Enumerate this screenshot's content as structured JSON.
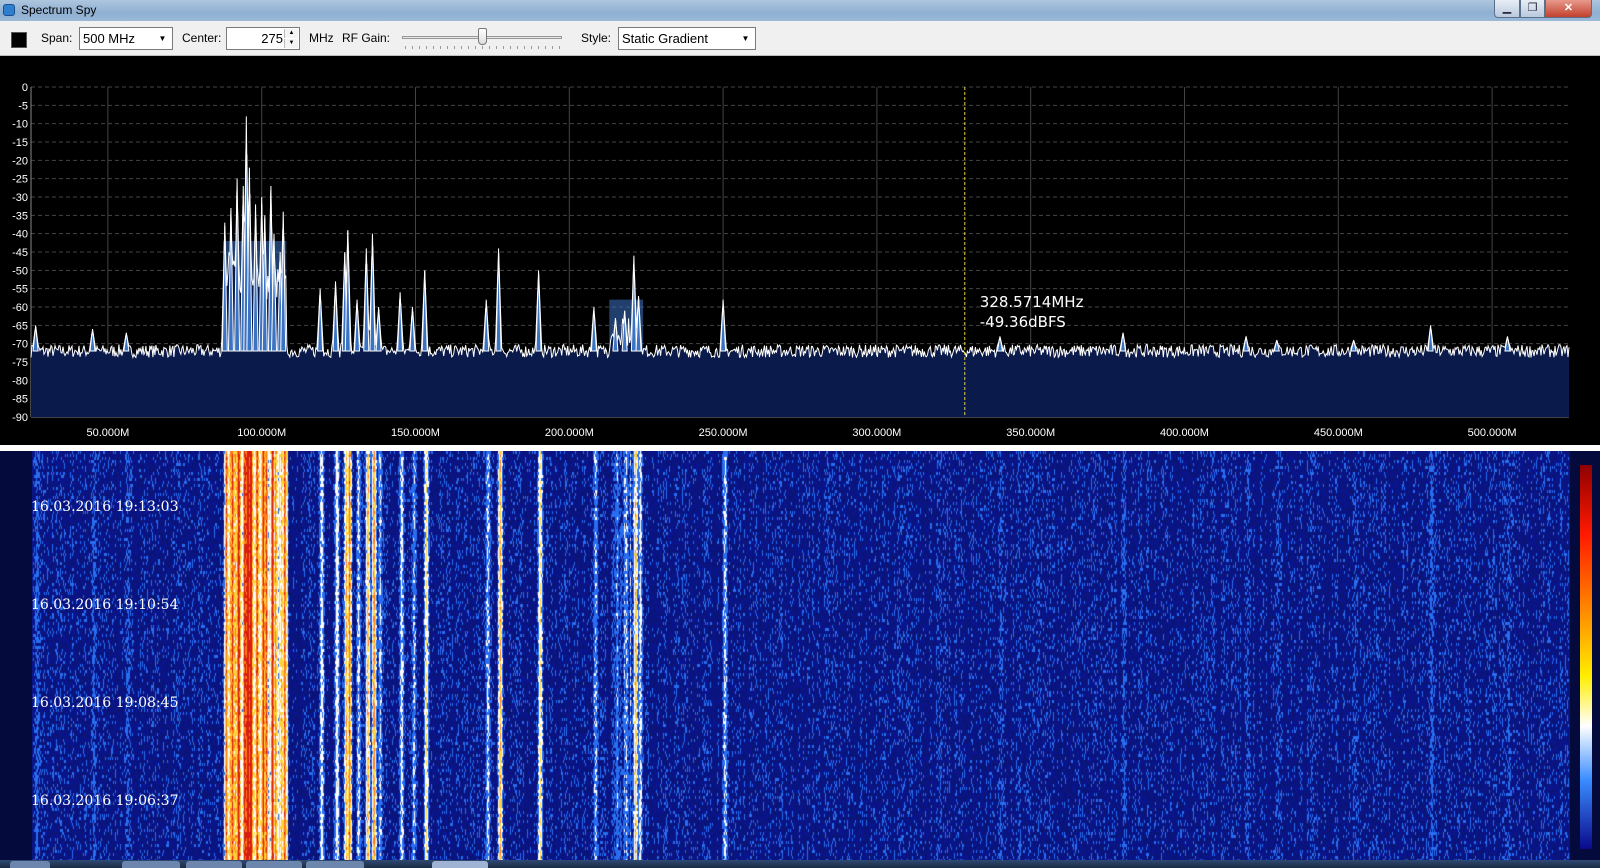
{
  "window": {
    "title": "Spectrum Spy",
    "min_glyph": "▁",
    "max_glyph": "❐",
    "close_glyph": "✕"
  },
  "toolbar": {
    "color_swatch": "#000000",
    "span_label": "Span:",
    "span_value": "500 MHz",
    "center_label": "Center:",
    "center_value": "275",
    "center_unit": "MHz",
    "rf_gain_label": "RF Gain:",
    "rf_gain_level": 0.5,
    "style_label": "Style:",
    "style_value": "Static Gradient",
    "dropdown_glyph": "▼",
    "spin_up_glyph": "▲",
    "spin_down_glyph": "▼"
  },
  "spectrum": {
    "y_ticks": [
      "0",
      "-5",
      "-10",
      "-15",
      "-20",
      "-25",
      "-30",
      "-35",
      "-40",
      "-45",
      "-50",
      "-55",
      "-60",
      "-65",
      "-70",
      "-75",
      "-80",
      "-85",
      "-90"
    ],
    "x_ticks": [
      "50.000M",
      "100.000M",
      "150.000M",
      "200.000M",
      "250.000M",
      "300.000M",
      "350.000M",
      "400.000M",
      "450.000M",
      "500.000M"
    ],
    "cursor_freq": "328.5714MHz",
    "cursor_level": "-49.36dBFS",
    "colors": {
      "background": "#000000",
      "trace": "#ffffff",
      "fill": "#0a1a4a",
      "peak_fill": "#3b73c4",
      "grid": "#444444",
      "cursor": "#e8d24a"
    }
  },
  "chart_data": {
    "type": "line",
    "title": "",
    "xlabel": "",
    "ylabel": "",
    "x_unit": "MHz",
    "y_unit": "dBFS",
    "xlim": [
      25,
      525
    ],
    "ylim": [
      -90,
      0
    ],
    "noise_floor": -72,
    "cursor": {
      "x": 328.5714,
      "y": -49.36
    },
    "peaks": [
      {
        "x": 26.5,
        "y": -65
      },
      {
        "x": 45,
        "y": -66
      },
      {
        "x": 56,
        "y": -67
      },
      {
        "x": 88,
        "y": -37
      },
      {
        "x": 90,
        "y": -33
      },
      {
        "x": 92,
        "y": -25
      },
      {
        "x": 94,
        "y": -27
      },
      {
        "x": 95,
        "y": -8
      },
      {
        "x": 96,
        "y": -22
      },
      {
        "x": 98,
        "y": -32
      },
      {
        "x": 100,
        "y": -30
      },
      {
        "x": 101,
        "y": -35
      },
      {
        "x": 103,
        "y": -27
      },
      {
        "x": 104,
        "y": -40
      },
      {
        "x": 106,
        "y": -45
      },
      {
        "x": 107,
        "y": -34
      },
      {
        "x": 119,
        "y": -55
      },
      {
        "x": 124,
        "y": -53
      },
      {
        "x": 127,
        "y": -45
      },
      {
        "x": 128,
        "y": -39
      },
      {
        "x": 131,
        "y": -58
      },
      {
        "x": 134,
        "y": -44
      },
      {
        "x": 136,
        "y": -40
      },
      {
        "x": 138,
        "y": -60
      },
      {
        "x": 145,
        "y": -56
      },
      {
        "x": 149,
        "y": -60
      },
      {
        "x": 153,
        "y": -50
      },
      {
        "x": 173,
        "y": -58
      },
      {
        "x": 177,
        "y": -44
      },
      {
        "x": 190,
        "y": -50
      },
      {
        "x": 208,
        "y": -60
      },
      {
        "x": 215,
        "y": -63
      },
      {
        "x": 218,
        "y": -61
      },
      {
        "x": 221,
        "y": -46
      },
      {
        "x": 222.5,
        "y": -57
      },
      {
        "x": 250,
        "y": -58
      },
      {
        "x": 340,
        "y": -68
      },
      {
        "x": 380,
        "y": -67
      },
      {
        "x": 420,
        "y": -68
      },
      {
        "x": 430,
        "y": -69
      },
      {
        "x": 455,
        "y": -69
      },
      {
        "x": 480,
        "y": -65
      },
      {
        "x": 505,
        "y": -68
      }
    ],
    "bands": [
      {
        "x_start": 87.5,
        "x_end": 108,
        "floor": -48
      },
      {
        "x_start": 213,
        "x_end": 224,
        "floor": -64
      }
    ]
  },
  "waterfall": {
    "timestamps": [
      "16.03.2016 19:13:03",
      "16.03.2016 19:10:54",
      "16.03.2016 19:08:45",
      "16.03.2016 19:06:37"
    ],
    "colors": {
      "background": "#050a3c",
      "hot": "#ffd23a",
      "warm": "#ff7a1a",
      "cool": "#2f7bff"
    }
  }
}
